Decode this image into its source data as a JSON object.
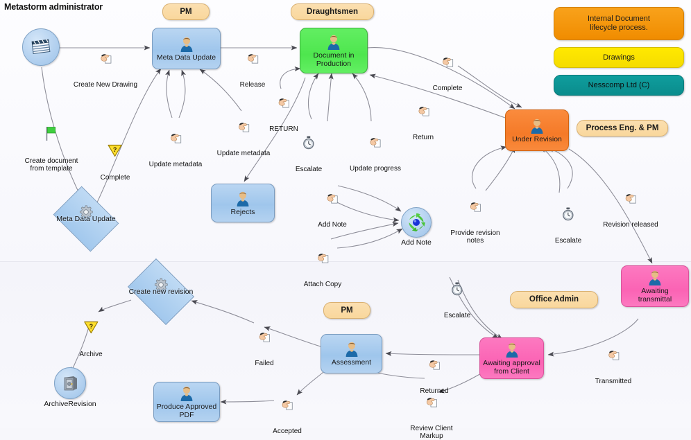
{
  "title": "Metastorm administrator",
  "legend": [
    {
      "id": "internal-document-lifecycle",
      "text": "Internal Document\nlifecycle process.",
      "color": "#f9a21b"
    },
    {
      "id": "drawings",
      "text": "Drawings",
      "color": "#ffe900"
    },
    {
      "id": "nesscomp-ltd",
      "text": "Nesscomp Ltd (C)",
      "color": "#0f9e9e"
    }
  ],
  "roles": [
    {
      "id": "role-pm-top",
      "label": "PM"
    },
    {
      "id": "role-draughtsmen",
      "label": "Draughtsmen"
    },
    {
      "id": "role-process-eng-pm",
      "label": "Process Eng. & PM"
    },
    {
      "id": "role-pm-bottom",
      "label": "PM"
    },
    {
      "id": "role-office-admin",
      "label": "Office Admin"
    }
  ],
  "nodes": [
    {
      "id": "start-drawing",
      "label": "",
      "shape": "circle",
      "icon": "clapperboard-icon"
    },
    {
      "id": "meta-data-update",
      "label": "Meta Data Update",
      "shape": "box",
      "color": "blue",
      "icon": "person-icon"
    },
    {
      "id": "document-in-production",
      "label": "Document in\nProduction",
      "shape": "box",
      "color": "green",
      "icon": "person-icon"
    },
    {
      "id": "under-revision",
      "label": "Under Revision",
      "shape": "box",
      "color": "orange",
      "icon": "person-icon"
    },
    {
      "id": "awaiting-transmittal",
      "label": "Awaiting transmittal",
      "shape": "box",
      "color": "pink",
      "icon": "person-icon"
    },
    {
      "id": "awaiting-approval-from-client",
      "label": "Awaiting approval\nfrom Client",
      "shape": "box",
      "color": "pink",
      "icon": "person-icon"
    },
    {
      "id": "assessment",
      "label": "Assessment",
      "shape": "box",
      "color": "blue",
      "icon": "person-icon"
    },
    {
      "id": "produce-approved-pdf",
      "label": "Produce Approved\nPDF",
      "shape": "box",
      "color": "blue",
      "icon": "person-icon"
    },
    {
      "id": "rejects",
      "label": "Rejects",
      "shape": "box",
      "color": "blue",
      "icon": "person-icon"
    },
    {
      "id": "meta-data-update-sub",
      "label": "Meta Data Update",
      "shape": "diamond",
      "icon": "gear-icon"
    },
    {
      "id": "create-new-revision",
      "label": "Create new revision",
      "shape": "diamond",
      "icon": "gear-icon"
    },
    {
      "id": "add-note",
      "label": "Add Note",
      "shape": "circle",
      "icon": "sync-icon"
    },
    {
      "id": "archive-revision",
      "label": "ArchiveRevision",
      "shape": "circle",
      "icon": "safe-icon"
    }
  ],
  "edge_labels": [
    {
      "id": "create-new-drawing",
      "text": "Create New Drawing",
      "icon": "hand-icon"
    },
    {
      "id": "release",
      "text": "Release",
      "icon": "hand-icon"
    },
    {
      "id": "complete-top",
      "text": "Complete",
      "icon": "hand-icon"
    },
    {
      "id": "return-upper",
      "text": "Return",
      "icon": "hand-icon"
    },
    {
      "id": "return-caps",
      "text": "RETURN",
      "icon": "hand-icon"
    },
    {
      "id": "update-metadata-left",
      "text": "Update metadata",
      "icon": "hand-icon"
    },
    {
      "id": "update-metadata-right",
      "text": "Update metadata",
      "icon": "hand-icon"
    },
    {
      "id": "escalate-production",
      "text": "Escalate",
      "icon": "stopwatch-icon"
    },
    {
      "id": "update-progress",
      "text": "Update progress",
      "icon": "hand-icon"
    },
    {
      "id": "create-document-from-template",
      "text": "Create document\nfrom template",
      "icon": "green-flag-icon"
    },
    {
      "id": "complete-flag",
      "text": "Complete",
      "icon": "yellow-triangle-icon"
    },
    {
      "id": "add-note-edge",
      "text": "Add Note",
      "icon": "hand-icon"
    },
    {
      "id": "attach-copy",
      "text": "Attach Copy",
      "icon": "hand-icon"
    },
    {
      "id": "provide-revision-notes",
      "text": "Provide revision\nnotes",
      "icon": "hand-icon"
    },
    {
      "id": "escalate-revision",
      "text": "Escalate",
      "icon": "stopwatch-icon"
    },
    {
      "id": "revision-released",
      "text": "Revision released",
      "icon": "hand-icon"
    },
    {
      "id": "transmitted",
      "text": "Transmitted",
      "icon": "hand-icon"
    },
    {
      "id": "escalate-approval",
      "text": "Escalate",
      "icon": "stopwatch-icon"
    },
    {
      "id": "returned",
      "text": "Returned",
      "icon": "hand-icon"
    },
    {
      "id": "review-client-markup",
      "text": "Review Client\nMarkup",
      "icon": "hand-icon"
    },
    {
      "id": "failed",
      "text": "Failed",
      "icon": "hand-icon"
    },
    {
      "id": "accepted",
      "text": "Accepted",
      "icon": "hand-icon"
    },
    {
      "id": "archive",
      "text": "Archive",
      "icon": "yellow-triangle-icon"
    }
  ],
  "colors": {
    "blue_node": "#a2c8ed",
    "green_node": "#4ee64e",
    "orange_node": "#f57a28",
    "pink_node": "#fb63b4",
    "role_pill": "#f9d79c",
    "legend_orange": "#f9a21b",
    "legend_yellow": "#ffe900",
    "legend_teal": "#0f9e9e",
    "edge_line": "#8a8a94",
    "background": "#f7f7fb"
  }
}
